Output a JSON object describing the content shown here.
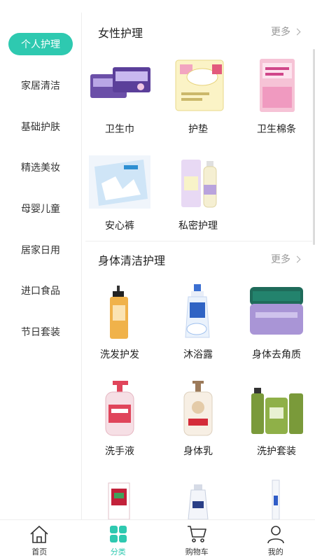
{
  "sidebar": {
    "items": [
      {
        "label": "个人护理",
        "active": true
      },
      {
        "label": "家居清洁",
        "active": false
      },
      {
        "label": "基础护肤",
        "active": false
      },
      {
        "label": "精选美妆",
        "active": false
      },
      {
        "label": "母婴儿童",
        "active": false
      },
      {
        "label": "居家日用",
        "active": false
      },
      {
        "label": "进口食品",
        "active": false
      },
      {
        "label": "节日套装",
        "active": false
      }
    ]
  },
  "sections": [
    {
      "title": "女性护理",
      "more": "更多",
      "products": [
        {
          "label": "卫生巾"
        },
        {
          "label": "护垫"
        },
        {
          "label": "卫生棉条"
        },
        {
          "label": "安心裤"
        },
        {
          "label": "私密护理"
        }
      ]
    },
    {
      "title": "身体清洁护理",
      "more": "更多",
      "products": [
        {
          "label": "洗发护发"
        },
        {
          "label": "沐浴露"
        },
        {
          "label": "身体去角质"
        },
        {
          "label": "洗手液"
        },
        {
          "label": "身体乳"
        },
        {
          "label": "洗护套装"
        }
      ]
    }
  ],
  "tabbar": {
    "tabs": [
      {
        "label": "首页",
        "icon": "home-icon"
      },
      {
        "label": "分类",
        "icon": "category-icon",
        "active": true
      },
      {
        "label": "购物车",
        "icon": "cart-icon"
      },
      {
        "label": "我的",
        "icon": "user-icon"
      }
    ]
  },
  "colors": {
    "accent": "#2ec9b0",
    "text": "#222222",
    "muted": "#999999"
  }
}
